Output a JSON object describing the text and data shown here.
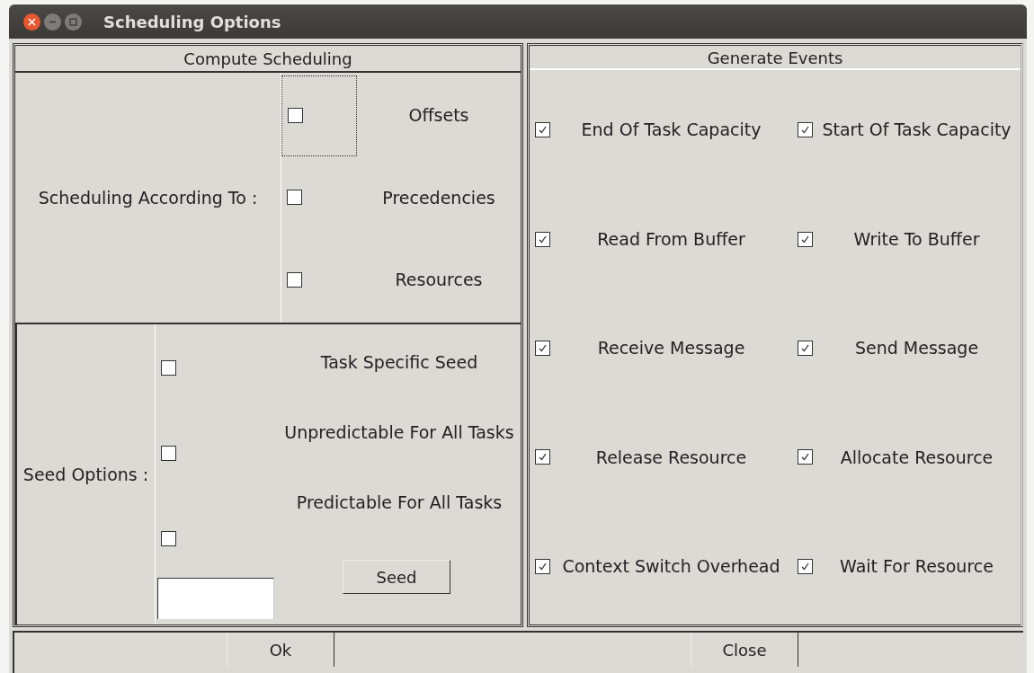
{
  "window": {
    "title": "Scheduling Options"
  },
  "compute_scheduling": {
    "title": "Compute Scheduling",
    "label": "Scheduling According To :",
    "options": [
      {
        "label": "Offsets",
        "checked": false,
        "focused": true
      },
      {
        "label": "Precedencies",
        "checked": false,
        "focused": false
      },
      {
        "label": "Resources",
        "checked": false,
        "focused": false
      }
    ]
  },
  "seed_options": {
    "label": "Seed Options :",
    "options": [
      {
        "label": "Task Specific Seed",
        "checked": false
      },
      {
        "label": "Unpredictable For All Tasks",
        "checked": false
      },
      {
        "label": "Predictable For All Tasks",
        "checked": false
      }
    ],
    "seed_button": "Seed"
  },
  "generate_events": {
    "title": "Generate Events",
    "events": [
      {
        "label": "End Of Task Capacity",
        "checked": true
      },
      {
        "label": "Start Of Task Capacity",
        "checked": true
      },
      {
        "label": "Read From Buffer",
        "checked": true
      },
      {
        "label": "Write To Buffer",
        "checked": true
      },
      {
        "label": "Receive Message",
        "checked": true
      },
      {
        "label": "Send Message",
        "checked": true
      },
      {
        "label": "Release Resource",
        "checked": true
      },
      {
        "label": "Allocate Resource",
        "checked": true
      },
      {
        "label": "Context Switch Overhead",
        "checked": true
      },
      {
        "label": "Wait For Resource",
        "checked": true
      }
    ]
  },
  "buttons": [
    "Ok",
    "Close"
  ]
}
